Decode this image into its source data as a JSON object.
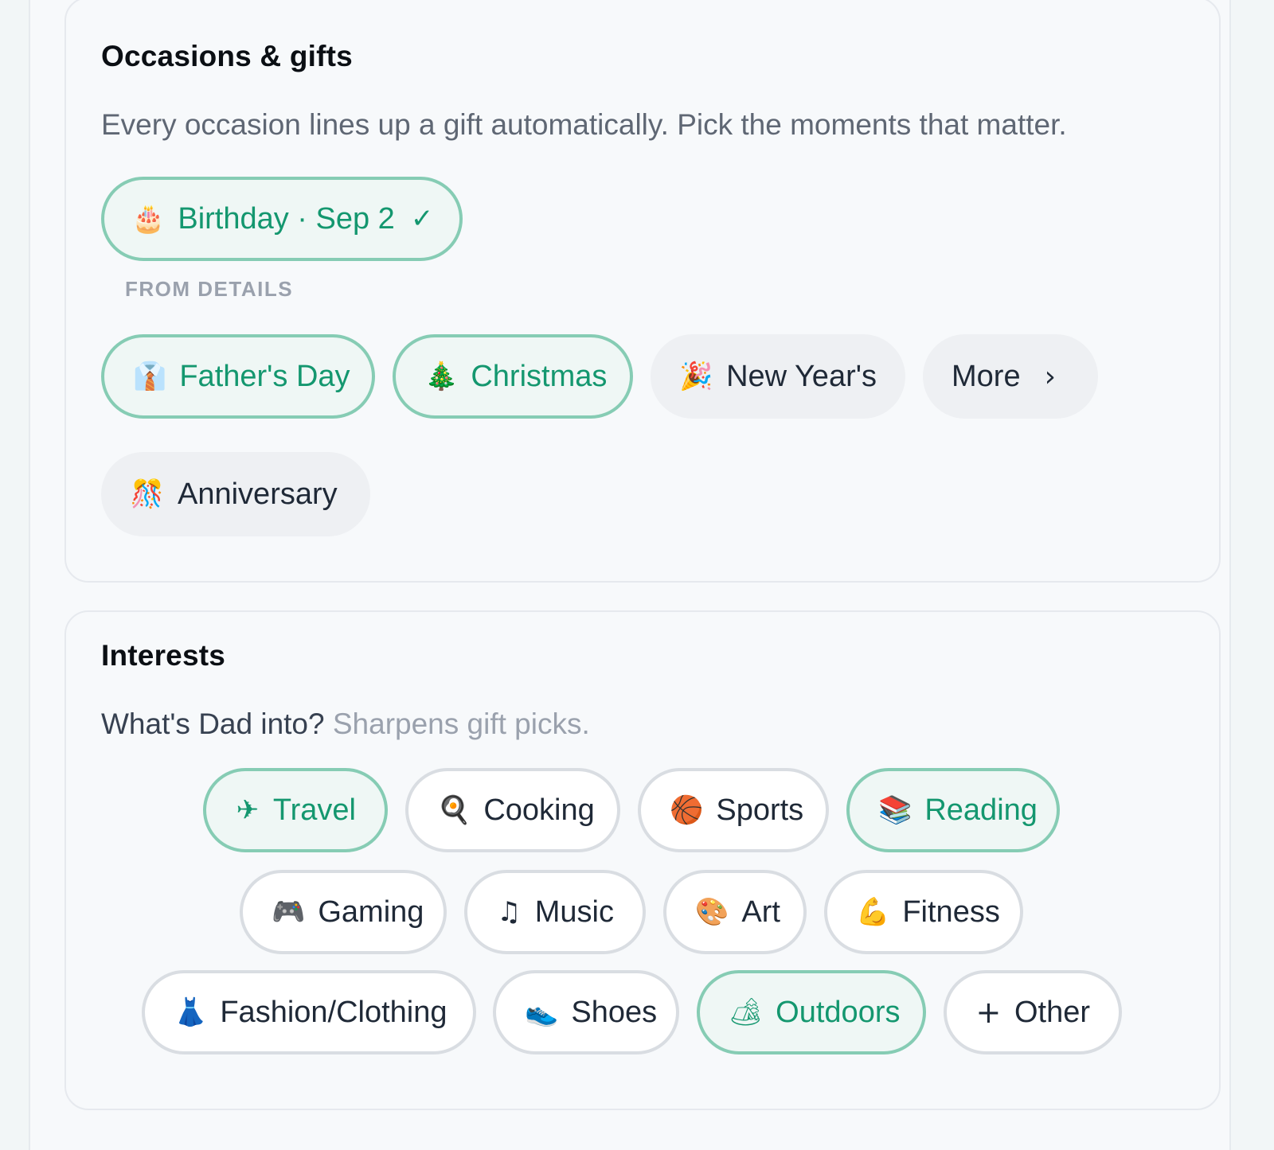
{
  "occasions": {
    "title": "Occasions & gifts",
    "description": "Every occasion lines up a gift automatically. Pick the moments that matter.",
    "birthday_chip": {
      "icon": "birthday-cake-icon",
      "glyph": "🎂",
      "label": "Birthday · Sep 2",
      "check": "✓"
    },
    "from_details_caption": "FROM DETAILS",
    "chips": [
      {
        "icon": "necktie-icon",
        "glyph": "👔",
        "label": "Father's Day",
        "selected": true
      },
      {
        "icon": "christmas-tree-icon",
        "glyph": "🎄",
        "label": "Christmas",
        "selected": true
      },
      {
        "icon": "party-popper-icon",
        "glyph": "🎉",
        "label": "New Year's",
        "selected": false
      },
      {
        "icon": "confetti-icon",
        "glyph": "🎊",
        "label": "Anniversary",
        "selected": false
      }
    ],
    "more_label": "More",
    "more_chevron": "›"
  },
  "interests": {
    "title": "Interests",
    "description_main": "What's Dad into?",
    "description_hint": "Sharpens gift picks.",
    "chips": [
      {
        "icon": "airplane-icon",
        "glyph": "✈",
        "label": "Travel",
        "selected": true
      },
      {
        "icon": "frying-pan-icon",
        "glyph": "🍳",
        "label": "Cooking",
        "selected": false
      },
      {
        "icon": "basketball-icon",
        "glyph": "🏀",
        "label": "Sports",
        "selected": false
      },
      {
        "icon": "books-icon",
        "glyph": "📚",
        "label": "Reading",
        "selected": true
      },
      {
        "icon": "game-controller-icon",
        "glyph": "🎮",
        "label": "Gaming",
        "selected": false
      },
      {
        "icon": "music-note-icon",
        "glyph": "♫",
        "label": "Music",
        "selected": false
      },
      {
        "icon": "palette-icon",
        "glyph": "🎨",
        "label": "Art",
        "selected": false
      },
      {
        "icon": "flexed-biceps-icon",
        "glyph": "💪",
        "label": "Fitness",
        "selected": false
      },
      {
        "icon": "dress-icon",
        "glyph": "👗",
        "label": "Fashion/Clothing",
        "selected": false
      },
      {
        "icon": "sneaker-icon",
        "glyph": "👟",
        "label": "Shoes",
        "selected": false
      },
      {
        "icon": "camping-icon",
        "glyph": "🏕",
        "label": "Outdoors",
        "selected": true
      }
    ],
    "other_label": "Other",
    "other_plus": "+"
  },
  "colors": {
    "selected_text": "#14976f",
    "selected_border": "#86ccb4",
    "selected_bg": "#eff7f5",
    "page_bg": "#f7f9fb"
  }
}
